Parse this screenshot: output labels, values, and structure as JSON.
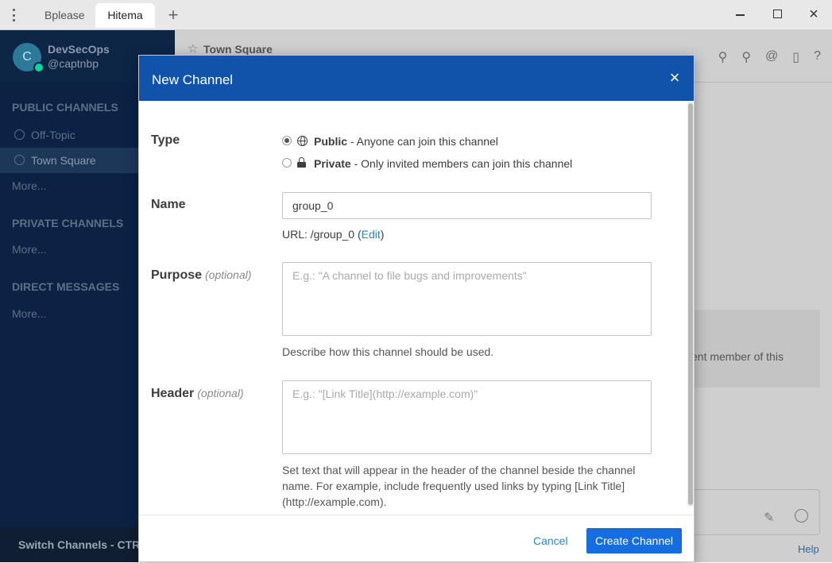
{
  "browser": {
    "tabs": [
      {
        "label": "Bplease"
      },
      {
        "label": "Hitema"
      }
    ],
    "new_tab": "+",
    "close_glyph": "×"
  },
  "sidebar": {
    "avatar_letter": "C",
    "team_name": "DevSecOps",
    "username": "@captnbp",
    "public_header": "PUBLIC CHANNELS",
    "public_items": [
      {
        "label": "Off-Topic"
      },
      {
        "label": "Town Square"
      }
    ],
    "public_more": "More...",
    "private_header": "PRIVATE CHANNELS",
    "private_more": "More...",
    "dm_header": "DIRECT MESSAGES",
    "dm_more": "More...",
    "switch_channels": "Switch Channels - CTRL+K"
  },
  "channel": {
    "star": "☆",
    "title": "Town Square",
    "intro_fragment": "ent member of this",
    "help": "Help"
  },
  "modal": {
    "title": "New Channel",
    "close": "×",
    "type_label": "Type",
    "public_option": {
      "title": "Public",
      "desc": " - Anyone can join this channel",
      "selected": true
    },
    "private_option": {
      "title": "Private",
      "desc": " - Only invited members can join this channel",
      "selected": false
    },
    "name_label": "Name",
    "name_value": "group_0",
    "url_prefix": "URL: /group_0 (",
    "url_edit": "Edit",
    "url_suffix": ")",
    "purpose_label": "Purpose",
    "purpose_optional": "(optional)",
    "purpose_placeholder": "E.g.: \"A channel to file bugs and improvements\"",
    "purpose_help": "Describe how this channel should be used.",
    "header_label": "Header",
    "header_optional": "(optional)",
    "header_placeholder": "E.g.: \"[Link Title](http://example.com)\"",
    "header_help": "Set text that will appear in the header of the channel beside the channel name. For example, include frequently used links by typing [Link Title](http://example.com).",
    "cancel": "Cancel",
    "create": "Create Channel"
  },
  "colors": {
    "modal_header": "#1153ab",
    "primary_button": "#166de0",
    "link": "#2389d7",
    "sidebar": "#0c2244"
  }
}
